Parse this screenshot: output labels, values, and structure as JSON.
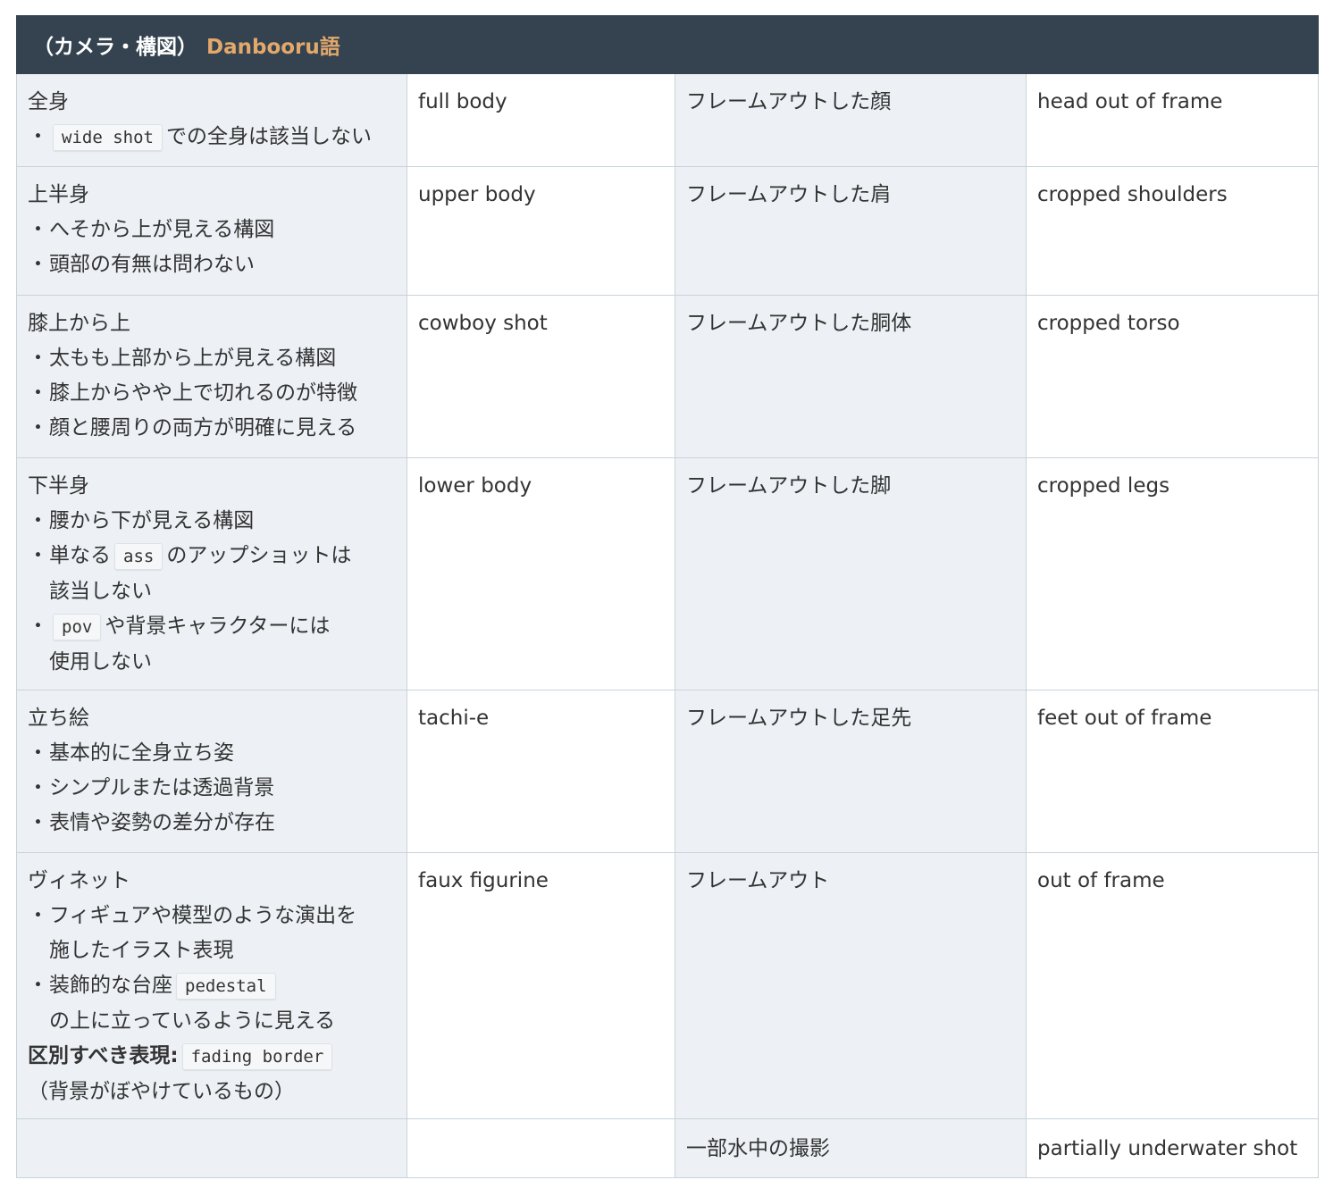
{
  "header": {
    "title": "（カメラ・構図）",
    "accent": "Danbooru語"
  },
  "rows": [
    {
      "desc_title": "全身",
      "desc_b1_code": "wide shot",
      "desc_b1_after": "での全身は該当しない",
      "tag": "full body",
      "third": "フレームアウトした顔",
      "fourth": "head out of frame"
    },
    {
      "desc_title": "上半身",
      "desc_b1": "へそから上が見える構図",
      "desc_b2": "頭部の有無は問わない",
      "tag": "upper body",
      "third": "フレームアウトした肩",
      "fourth": "cropped shoulders"
    },
    {
      "desc_title": "膝上から上",
      "desc_b1": "太もも上部から上が見える構図",
      "desc_b2": "膝上からやや上で切れるのが特徴",
      "desc_b3": "顔と腰周りの両方が明確に見える",
      "tag": "cowboy shot",
      "third": "フレームアウトした胴体",
      "fourth": "cropped torso"
    },
    {
      "desc_title": "下半身",
      "desc_b1": "腰から下が見える構図",
      "desc_b2_before": "単なる",
      "desc_b2_code": "ass",
      "desc_b2_after": "のアップショットは",
      "desc_b2_cont": "該当しない",
      "desc_b3_code": "pov",
      "desc_b3_after": "や背景キャラクターには",
      "desc_b3_cont": "使用しない",
      "tag": "lower body",
      "third": "フレームアウトした脚",
      "fourth": "cropped legs"
    },
    {
      "desc_title": "立ち絵",
      "desc_b1": "基本的に全身立ち姿",
      "desc_b2": "シンプルまたは透過背景",
      "desc_b3": "表情や姿勢の差分が存在",
      "tag": "tachi-e",
      "third": "フレームアウトした足先",
      "fourth": "feet out of frame"
    },
    {
      "desc_title": "ヴィネット",
      "desc_b1": "フィギュアや模型のような演出を",
      "desc_b1_cont": "施したイラスト表現",
      "desc_b2_before": "装飾的な台座",
      "desc_b2_code": "pedestal",
      "desc_b2_cont": "の上に立っているように見える",
      "note_label": "区別すべき表現:",
      "note_code": "fading border",
      "note_paren": "（背景がぼやけているもの）",
      "tag": "faux figurine",
      "third": "フレームアウト",
      "fourth": "out of frame"
    },
    {
      "desc_title": "",
      "tag": "",
      "third": "一部水中の撮影",
      "fourth": "partially underwater shot"
    }
  ]
}
